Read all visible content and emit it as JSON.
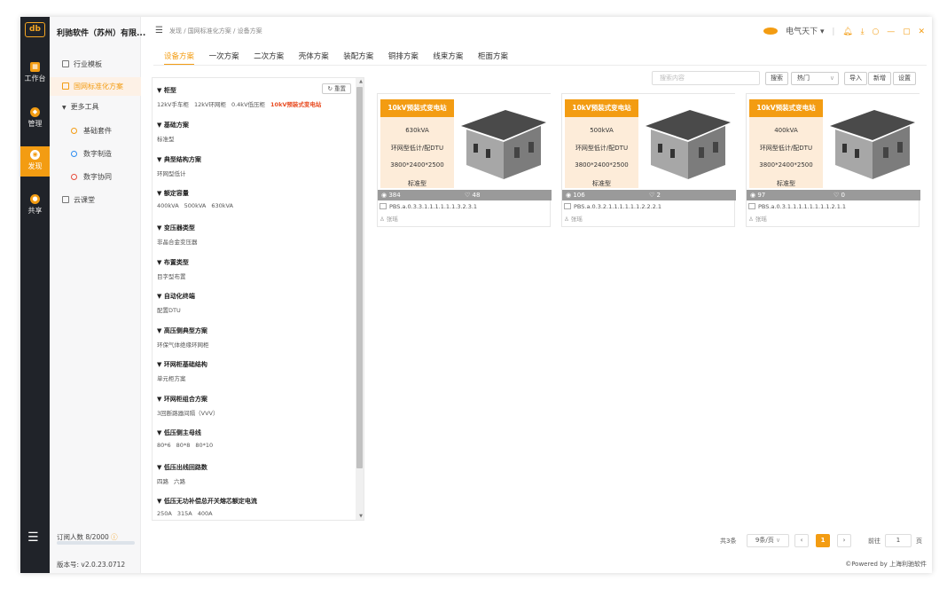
{
  "app": {
    "logo_text": "db",
    "company": "利驰软件（苏州）有限...",
    "subscribers_label": "订阅人数 8/2000",
    "version": "版本号: v2.0.23.0712",
    "powered_by": "©Powered by 上海利驰软件",
    "accent_color": "#f39c12"
  },
  "rail": [
    {
      "label": "工作台",
      "icon": "dashboard-icon"
    },
    {
      "label": "管理",
      "icon": "manage-icon"
    },
    {
      "label": "发现",
      "icon": "discover-icon",
      "active": true
    },
    {
      "label": "共享",
      "icon": "share-icon"
    }
  ],
  "sidebar": {
    "items": [
      {
        "label": "行业模板",
        "icon": "template-icon"
      },
      {
        "label": "国网标准化方案",
        "icon": "standard-icon",
        "active": true
      },
      {
        "label": "更多工具",
        "icon": "caret-down-icon"
      },
      {
        "label": "基础套件",
        "icon": "suite-icon"
      },
      {
        "label": "数字制造",
        "icon": "manufacturing-icon"
      },
      {
        "label": "数字协同",
        "icon": "collaboration-icon"
      },
      {
        "label": "云课堂",
        "icon": "classroom-icon"
      }
    ]
  },
  "header": {
    "breadcrumb": "发现 / 国网标准化方案 / 设备方案",
    "user": "电气天下 ▾",
    "window_controls": [
      "bell-icon",
      "download-icon",
      "refresh-icon",
      "minimize-icon",
      "maximize-icon",
      "close-icon"
    ]
  },
  "tabs": [
    "设备方案",
    "一次方案",
    "二次方案",
    "壳体方案",
    "装配方案",
    "铜排方案",
    "线束方案",
    "柜面方案"
  ],
  "filter": {
    "reset_label": "重置",
    "groups": [
      {
        "title": "▼ 柜型",
        "values": [
          "12kV手车柜",
          "12kV环网柜",
          "0.4kV低压柜",
          "10kV预装式变电站"
        ],
        "selected": 3
      },
      {
        "title": "▼ 基础方案",
        "values": [
          "标准型"
        ]
      },
      {
        "title": "▼ 典型结构方案",
        "values": [
          "环网型低计"
        ]
      },
      {
        "title": "▼ 额定容量",
        "values": [
          "400kVA",
          "500kVA",
          "630kVA"
        ]
      },
      {
        "title": "▼ 变压器类型",
        "values": [
          "非晶合金变压器"
        ]
      },
      {
        "title": "▼ 布置类型",
        "values": [
          "目字型布置"
        ]
      },
      {
        "title": "▼ 自动化终端",
        "values": [
          "配置DTU"
        ]
      },
      {
        "title": "▼ 高压侧典型方案",
        "values": [
          "环保气体绝缘环网柜"
        ]
      },
      {
        "title": "▼ 环网柜基础结构",
        "values": [
          "单元柜方案"
        ]
      },
      {
        "title": "▼ 环网柜组合方案",
        "values": [
          "3回断路器间隔（VVV）"
        ]
      },
      {
        "title": "▼ 低压侧主母线",
        "values": [
          "80*6",
          "80*8",
          "80*10"
        ]
      },
      {
        "title": "▼ 低压出线回路数",
        "values": [
          "四路",
          "六路"
        ]
      },
      {
        "title": "▼ 低压无功补偿总开关熔芯额定电流",
        "values": [
          "250A",
          "315A",
          "400A"
        ]
      }
    ]
  },
  "toolbar": {
    "search_placeholder": "搜索内容",
    "search_label": "搜索",
    "sort_value": "热门",
    "import_label": "导入",
    "new_label": "新增",
    "settings_label": "设置"
  },
  "cards": [
    {
      "badge": "10kV预装式变电站",
      "specs": [
        "630kVA",
        "环网型低计/配DTU",
        "3800*2400*2500",
        "标准型"
      ],
      "views": "384",
      "likes": "48",
      "code": "PBS.a.0.3.3.1.1.1.1.1.1.3.2.3.1",
      "owner": "张瑶"
    },
    {
      "badge": "10kV预装式变电站",
      "specs": [
        "500kVA",
        "环网型低计/配DTU",
        "3800*2400*2500",
        "标准型"
      ],
      "views": "106",
      "likes": "2",
      "code": "PBS.a.0.3.2.1.1.1.1.1.1.2.2.2.1",
      "owner": "张瑶"
    },
    {
      "badge": "10kV预装式变电站",
      "specs": [
        "400kVA",
        "环网型低计/配DTU",
        "3800*2400*2500",
        "标准型"
      ],
      "views": "97",
      "likes": "0",
      "code": "PBS.a.0.3.1.1.1.1.1.1.1.1.2.1.1",
      "owner": "张瑶"
    }
  ],
  "pagination": {
    "total": "共3条",
    "page_size": "9条/页",
    "current": "1",
    "goto_label": "前往",
    "goto_value": "1",
    "page_suffix": "页"
  }
}
